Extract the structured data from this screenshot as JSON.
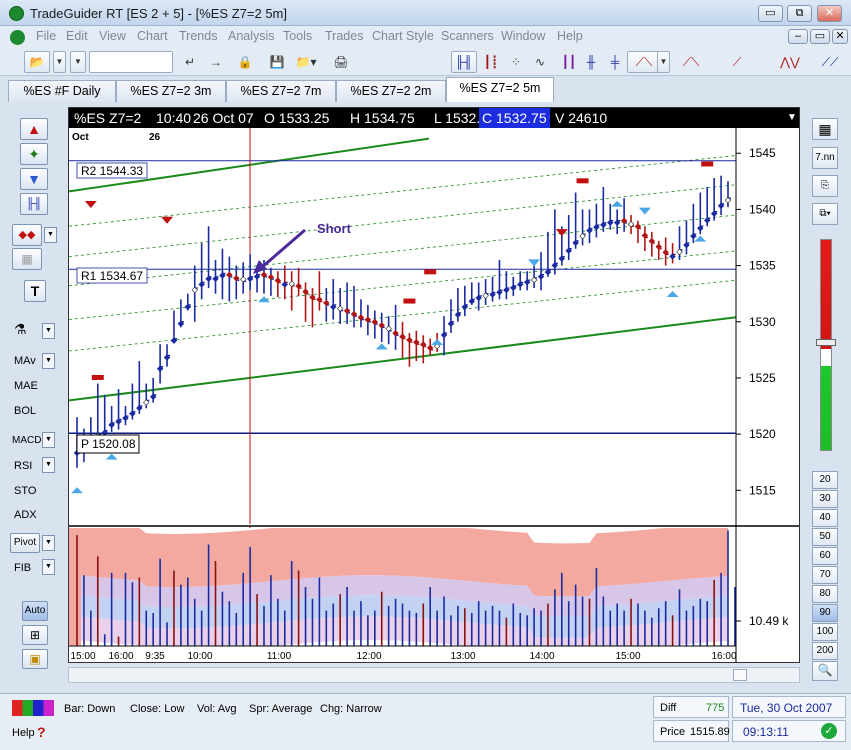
{
  "window": {
    "title": "TradeGuider RT   [ES 2 + 5] - [%ES Z7=2 5m]",
    "buttons": [
      "▭",
      "⧉",
      "✕"
    ],
    "mdi_buttons": [
      "–",
      "▭",
      "✕"
    ]
  },
  "menu": [
    "File",
    "Edit",
    "View",
    "Chart",
    "Trends",
    "Analysis",
    "Tools",
    "Trades",
    "Chart Style",
    "Scanners",
    "Window",
    "Help"
  ],
  "tabs": [
    {
      "label": "%ES #F Daily",
      "active": false
    },
    {
      "label": "%ES Z7=2 3m",
      "active": false
    },
    {
      "label": "%ES Z7=2 7m",
      "active": false
    },
    {
      "label": "%ES Z7=2 2m",
      "active": false
    },
    {
      "label": "%ES Z7=2 5m",
      "active": true
    }
  ],
  "left_tools": {
    "labels": [
      "MAv",
      "MAE",
      "BOL",
      "MACD",
      "RSI",
      "STO",
      "ADX",
      "Pivot",
      "FIB",
      "Auto"
    ],
    "text_tool": "T"
  },
  "chart_header": {
    "symbol": "%ES Z7=2",
    "time": "10:40",
    "date": "26 Oct 07",
    "open": "O 1533.25",
    "high": "H 1534.75",
    "low": "L 1532.25",
    "close": "C 1532.75",
    "volume": "V 24610"
  },
  "date_row": {
    "month": "Oct",
    "day": "26"
  },
  "pivot_labels": {
    "r2": "R2 1544.33",
    "r1": "R1 1534.67",
    "p": "P 1520.08"
  },
  "annotation": "Short",
  "volume_label": "10.49 k",
  "right_tools": {
    "period_label": "7.nn",
    "bar_counts": [
      "20",
      "30",
      "40",
      "50",
      "60",
      "70",
      "80",
      "90",
      "100",
      "200"
    ]
  },
  "status": {
    "bar": "Bar: Down",
    "close": "Close: Low",
    "vol": "Vol: Avg",
    "spr": "Spr: Average",
    "chg": "Chg: Narrow",
    "help": "Help",
    "diff_label": "Diff",
    "diff_value": "775",
    "price_label": "Price",
    "price_value": "1515.89",
    "date": "Tue, 30 Oct 2007",
    "clock": "09:13:11"
  },
  "chart_data": {
    "type": "candlestick",
    "y_ticks": [
      1545,
      1540,
      1535,
      1530,
      1525,
      1520,
      1515
    ],
    "ylim": [
      1512,
      1546
    ],
    "x_ticks": [
      "15:00",
      "16:00",
      "9:35",
      "10:00",
      "11:00",
      "12:00",
      "13:00",
      "14:00",
      "15:00",
      "16:00"
    ],
    "pivots": {
      "R2": 1544.33,
      "R1": 1534.67,
      "P": 1520.08
    },
    "bars": [
      [
        1518.5,
        1521.5,
        1517
      ],
      [
        1519,
        1520.5,
        1517.5
      ],
      [
        1519.5,
        1521.5,
        1518.8
      ],
      [
        1520,
        1524.5,
        1519.3
      ],
      [
        1520.3,
        1523.5,
        1519.6
      ],
      [
        1521,
        1522.5,
        1520.2
      ],
      [
        1521.3,
        1524,
        1520.4
      ],
      [
        1521.6,
        1522.5,
        1520.8
      ],
      [
        1522,
        1524.5,
        1521.3
      ],
      [
        1522.5,
        1526.5,
        1521.8
      ],
      [
        1523,
        1524.5,
        1522.3
      ],
      [
        1523.5,
        1525,
        1522.8
      ],
      [
        1526,
        1528,
        1524.5
      ],
      [
        1527,
        1528,
        1526
      ],
      [
        1528.5,
        1531,
        1528.1
      ],
      [
        1530,
        1532,
        1529.5
      ],
      [
        1531.5,
        1532.5,
        1531
      ],
      [
        1533,
        1535,
        1530
      ],
      [
        1533.5,
        1537,
        1532
      ],
      [
        1534,
        1538.5,
        1533
      ],
      [
        1534,
        1535.5,
        1532.5
      ],
      [
        1534.3,
        1536.5,
        1532
      ],
      [
        1534,
        1535.8,
        1531.8
      ],
      [
        1533.7,
        1535,
        1532
      ],
      [
        1533.6,
        1535.3,
        1532.5
      ],
      [
        1534,
        1536,
        1532.8
      ],
      [
        1534.2,
        1535,
        1532.6
      ],
      [
        1534,
        1535.5,
        1532.5
      ],
      [
        1533.8,
        1534.8,
        1532.3
      ],
      [
        1533.5,
        1534.5,
        1532.2
      ],
      [
        1533.5,
        1535,
        1532
      ],
      [
        1533.2,
        1534.5,
        1531
      ],
      [
        1533,
        1534.8,
        1532.3
      ],
      [
        1532.5,
        1533.5,
        1530
      ],
      [
        1532,
        1533,
        1529.5
      ],
      [
        1531.8,
        1534.5,
        1531
      ],
      [
        1531.5,
        1533,
        1530
      ],
      [
        1531.5,
        1533.8,
        1530.2
      ],
      [
        1531,
        1533,
        1529.8
      ],
      [
        1530.8,
        1533.5,
        1529.8
      ],
      [
        1530.5,
        1533.2,
        1529.5
      ],
      [
        1530.2,
        1532,
        1529.5
      ],
      [
        1530,
        1531.5,
        1528.8
      ],
      [
        1529.8,
        1531,
        1528.5
      ],
      [
        1529.5,
        1530.8,
        1528.2
      ],
      [
        1529.2,
        1530.5,
        1528
      ],
      [
        1528.8,
        1531.5,
        1527.5
      ],
      [
        1528.5,
        1530,
        1526.8
      ],
      [
        1528.2,
        1529,
        1526
      ],
      [
        1528,
        1529.2,
        1526.5
      ],
      [
        1527.8,
        1528.8,
        1526.3
      ],
      [
        1527.5,
        1528.5,
        1527
      ],
      [
        1528,
        1529,
        1527.3
      ],
      [
        1529,
        1530.5,
        1527
      ],
      [
        1530,
        1532,
        1529
      ],
      [
        1530.8,
        1533,
        1530
      ],
      [
        1531.5,
        1533.2,
        1530.5
      ],
      [
        1532,
        1533.5,
        1531.5
      ],
      [
        1532.3,
        1533.5,
        1531
      ],
      [
        1532.5,
        1533.8,
        1531.5
      ],
      [
        1532.6,
        1534,
        1531.8
      ],
      [
        1532.8,
        1535.5,
        1532
      ],
      [
        1533,
        1534.5,
        1532
      ],
      [
        1533.2,
        1534,
        1532.3
      ],
      [
        1533.5,
        1534.5,
        1532.8
      ],
      [
        1533.7,
        1534.5,
        1532.8
      ],
      [
        1533.9,
        1535.5,
        1533
      ],
      [
        1534.2,
        1536.2,
        1532.8
      ],
      [
        1534.6,
        1538,
        1534
      ],
      [
        1535.2,
        1540,
        1534.2
      ],
      [
        1535.8,
        1538.5,
        1535
      ],
      [
        1536.5,
        1539.5,
        1535.5
      ],
      [
        1537.2,
        1541.5,
        1536.5
      ],
      [
        1537.8,
        1540,
        1536.8
      ],
      [
        1538.3,
        1540,
        1537
      ],
      [
        1538.6,
        1540.5,
        1537.5
      ],
      [
        1538.8,
        1542,
        1538
      ],
      [
        1539,
        1540.5,
        1538.2
      ],
      [
        1539,
        1540,
        1537.8
      ],
      [
        1538.8,
        1541,
        1538
      ],
      [
        1538.5,
        1539.5,
        1537.8
      ],
      [
        1538.3,
        1539,
        1537
      ],
      [
        1537.5,
        1538.5,
        1536.3
      ],
      [
        1537,
        1538,
        1535.8
      ],
      [
        1536.5,
        1537.2,
        1535.5
      ],
      [
        1536,
        1537.5,
        1535
      ],
      [
        1536,
        1537,
        1535.2
      ],
      [
        1536.4,
        1538.5,
        1535.5
      ],
      [
        1537,
        1539,
        1536
      ],
      [
        1537.8,
        1540.5,
        1537
      ],
      [
        1538.5,
        1541.5,
        1537.8
      ],
      [
        1539.2,
        1542,
        1538.5
      ],
      [
        1539.8,
        1542.8,
        1539
      ],
      [
        1540.5,
        1543,
        1539.5
      ],
      [
        1541,
        1542.5,
        1540.2
      ]
    ],
    "volume": [
      0.94,
      0.6,
      0.3,
      0.76,
      0.1,
      0.62,
      0.08,
      0.62,
      0.54,
      0.58,
      0.3,
      0.28,
      0.74,
      0.2,
      0.64,
      0.52,
      0.58,
      0.4,
      0.3,
      0.86,
      0.72,
      0.46,
      0.38,
      0.28,
      0.62,
      0.84,
      0.44,
      0.34,
      0.6,
      0.4,
      0.3,
      0.72,
      0.64,
      0.5,
      0.4,
      0.58,
      0.3,
      0.36,
      0.44,
      0.5,
      0.3,
      0.38,
      0.26,
      0.3,
      0.46,
      0.34,
      0.4,
      0.36,
      0.3,
      0.28,
      0.36,
      0.5,
      0.3,
      0.42,
      0.26,
      0.34,
      0.32,
      0.28,
      0.38,
      0.3,
      0.34,
      0.3,
      0.24,
      0.36,
      0.28,
      0.26,
      0.32,
      0.3,
      0.36,
      0.48,
      0.62,
      0.38,
      0.52,
      0.42,
      0.4,
      0.66,
      0.42,
      0.3,
      0.36,
      0.3,
      0.4,
      0.36,
      0.3,
      0.24,
      0.32,
      0.38,
      0.26,
      0.48,
      0.3,
      0.34,
      0.4,
      0.38,
      0.56,
      0.62,
      0.98,
      0.5
    ]
  }
}
